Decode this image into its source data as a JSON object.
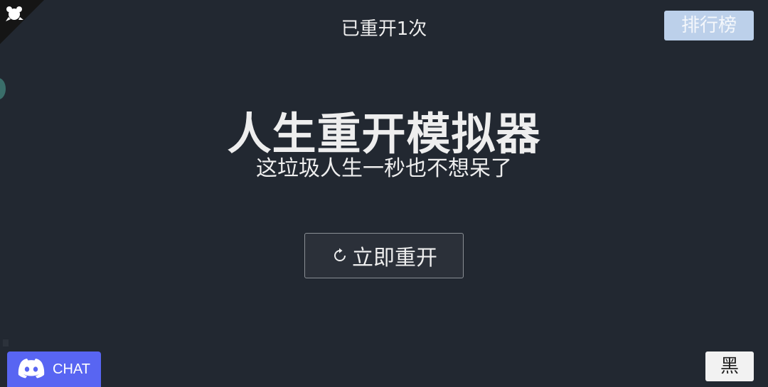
{
  "header": {
    "restart_count": "已重开1次",
    "rank_button": "排行榜"
  },
  "main": {
    "title": "人生重开模拟器",
    "subtitle": "这垃圾人生一秒也不想呆了",
    "restart_button": "立即重开"
  },
  "footer": {
    "chat_button": "CHAT",
    "theme_button": "黑"
  },
  "colors": {
    "background": "#222831",
    "rank_button_bg": "#bcd0ea",
    "discord_blurple": "#5865f2"
  },
  "icons": {
    "corner": "github-corner-icon",
    "restart": "refresh-icon",
    "chat": "discord-icon"
  }
}
